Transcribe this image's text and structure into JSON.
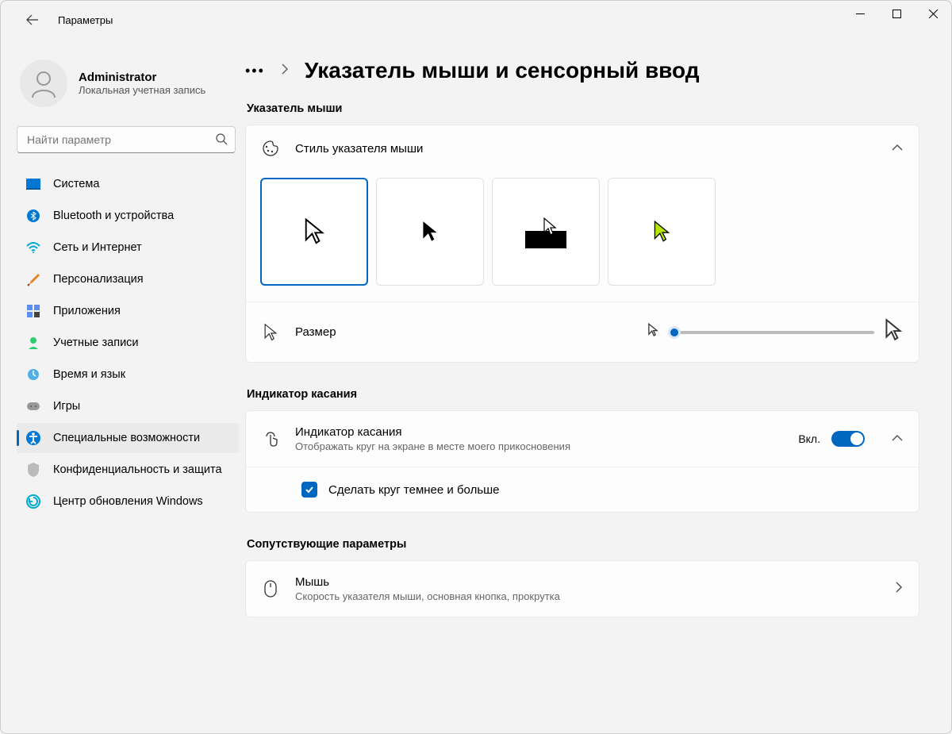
{
  "window": {
    "title": "Параметры"
  },
  "user": {
    "name": "Administrator",
    "sub": "Локальная учетная запись"
  },
  "search": {
    "placeholder": "Найти параметр"
  },
  "nav": {
    "items": [
      {
        "label": "Система"
      },
      {
        "label": "Bluetooth и устройства"
      },
      {
        "label": "Сеть и Интернет"
      },
      {
        "label": "Персонализация"
      },
      {
        "label": "Приложения"
      },
      {
        "label": "Учетные записи"
      },
      {
        "label": "Время и язык"
      },
      {
        "label": "Игры"
      },
      {
        "label": "Специальные возможности"
      },
      {
        "label": "Конфиденциальность и защита"
      },
      {
        "label": "Центр обновления Windows"
      }
    ]
  },
  "page": {
    "title": "Указатель мыши и сенсорный ввод"
  },
  "sections": {
    "pointer": {
      "heading": "Указатель мыши",
      "styleCard": {
        "title": "Стиль указателя мыши"
      },
      "sizeCard": {
        "title": "Размер"
      }
    },
    "touch": {
      "heading": "Индикатор касания",
      "card": {
        "title": "Индикатор касания",
        "sub": "Отображать круг на экране в месте моего прикосновения",
        "toggleLabel": "Вкл.",
        "checkboxLabel": "Сделать круг темнее и больше"
      }
    },
    "related": {
      "heading": "Сопутствующие параметры",
      "mouse": {
        "title": "Мышь",
        "sub": "Скорость указателя мыши, основная кнопка, прокрутка"
      }
    }
  }
}
